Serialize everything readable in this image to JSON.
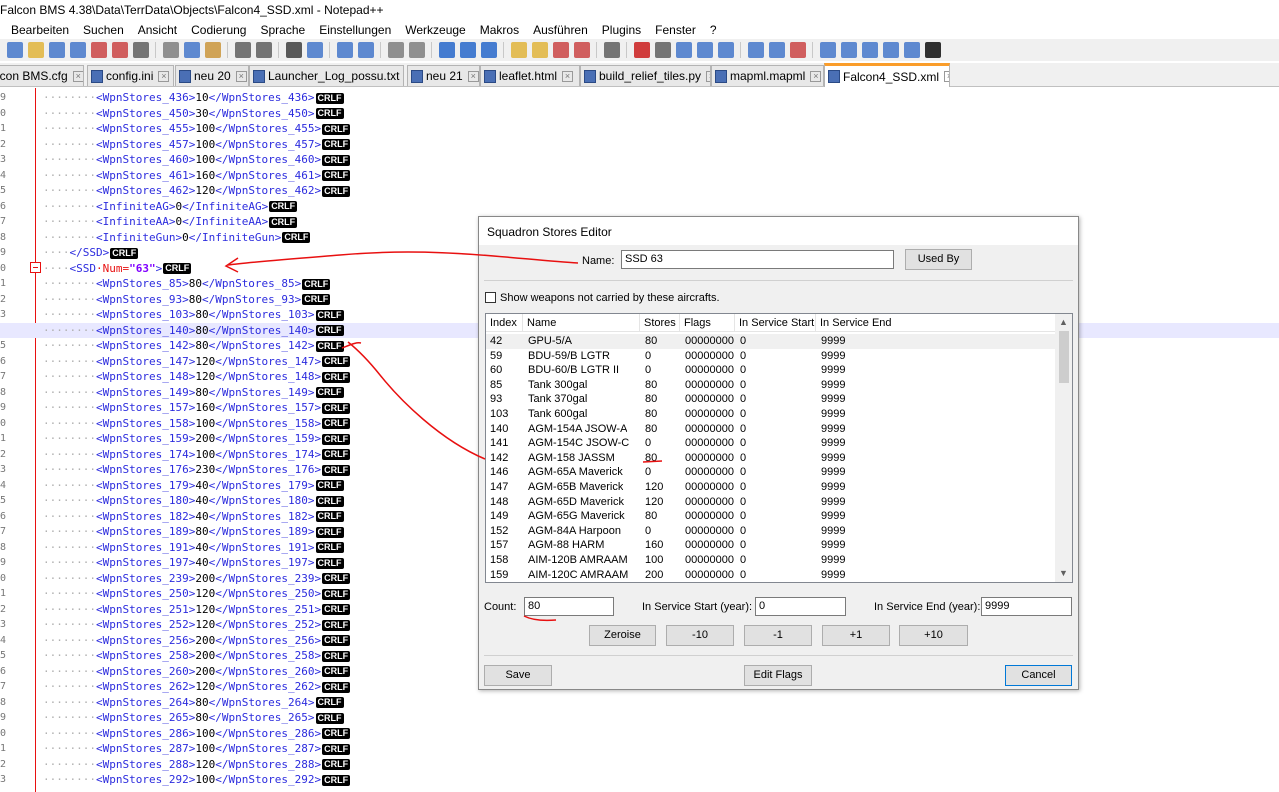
{
  "window": {
    "title": "Falcon BMS 4.38\\Data\\TerrData\\Objects\\Falcon4_SSD.xml - Notepad++"
  },
  "menu": [
    "Bearbeiten",
    "Suchen",
    "Ansicht",
    "Codierung",
    "Sprache",
    "Einstellungen",
    "Werkzeuge",
    "Makros",
    "Ausführen",
    "Plugins",
    "Fenster",
    "?"
  ],
  "tabs": [
    {
      "label": "lcon BMS.cfg"
    },
    {
      "label": "config.ini"
    },
    {
      "label": "neu 20"
    },
    {
      "label": "Launcher_Log_possu.txt"
    },
    {
      "label": "neu 21"
    },
    {
      "label": "leaflet.html"
    },
    {
      "label": "build_relief_tiles.py"
    },
    {
      "label": "mapml.mapml"
    },
    {
      "label": "Falcon4_SSD.xml"
    }
  ],
  "editor": {
    "line_numbers": [
      "9",
      "0",
      "1",
      "2",
      "3",
      "4",
      "5",
      "6",
      "7",
      "8",
      "9",
      "0",
      "1",
      "2",
      "3",
      "4",
      "5",
      "6",
      "7",
      "8",
      "9",
      "0",
      "1",
      "2",
      "3",
      "4",
      "5",
      "6",
      "7",
      "8",
      "9",
      "0",
      "1",
      "2",
      "3",
      "4",
      "5",
      "6",
      "7",
      "8",
      "9",
      "0",
      "1",
      "2",
      "3"
    ],
    "eol": "CRLF",
    "lines": [
      {
        "dots": "········",
        "open": "<WpnStores_436>",
        "value": "10",
        "close": "</WpnStores_436>"
      },
      {
        "dots": "········",
        "open": "<WpnStores_450>",
        "value": "30",
        "close": "</WpnStores_450>"
      },
      {
        "dots": "········",
        "open": "<WpnStores_455>",
        "value": "100",
        "close": "</WpnStores_455>"
      },
      {
        "dots": "········",
        "open": "<WpnStores_457>",
        "value": "100",
        "close": "</WpnStores_457>"
      },
      {
        "dots": "········",
        "open": "<WpnStores_460>",
        "value": "100",
        "close": "</WpnStores_460>"
      },
      {
        "dots": "········",
        "open": "<WpnStores_461>",
        "value": "160",
        "close": "</WpnStores_461>"
      },
      {
        "dots": "········",
        "open": "<WpnStores_462>",
        "value": "120",
        "close": "</WpnStores_462>"
      },
      {
        "dots": "········",
        "open": "<InfiniteAG>",
        "value": "0",
        "close": "</InfiniteAG>"
      },
      {
        "dots": "········",
        "open": "<InfiniteAA>",
        "value": "0",
        "close": "</InfiniteAA>"
      },
      {
        "dots": "········",
        "open": "<InfiniteGun>",
        "value": "0",
        "close": "</InfiniteGun>"
      },
      {
        "dots": "····",
        "open": "</SSD>",
        "value": "",
        "close": ""
      },
      {
        "dots": "····",
        "open": "<SSD",
        "attr": "·Num=",
        "attrval": "\"63\"",
        "open2": ">",
        "value": "",
        "close": ""
      },
      {
        "dots": "········",
        "open": "<WpnStores_85>",
        "value": "80",
        "close": "</WpnStores_85>"
      },
      {
        "dots": "········",
        "open": "<WpnStores_93>",
        "value": "80",
        "close": "</WpnStores_93>"
      },
      {
        "dots": "········",
        "open": "<WpnStores_103>",
        "value": "80",
        "close": "</WpnStores_103>"
      },
      {
        "dots": "········",
        "open": "<WpnStores_140>",
        "value": "80",
        "close": "</WpnStores_140>"
      },
      {
        "dots": "········",
        "open": "<WpnStores_142>",
        "value": "80",
        "close": "</WpnStores_142>"
      },
      {
        "dots": "········",
        "open": "<WpnStores_147>",
        "value": "120",
        "close": "</WpnStores_147>"
      },
      {
        "dots": "········",
        "open": "<WpnStores_148>",
        "value": "120",
        "close": "</WpnStores_148>"
      },
      {
        "dots": "········",
        "open": "<WpnStores_149>",
        "value": "80",
        "close": "</WpnStores_149>"
      },
      {
        "dots": "········",
        "open": "<WpnStores_157>",
        "value": "160",
        "close": "</WpnStores_157>"
      },
      {
        "dots": "········",
        "open": "<WpnStores_158>",
        "value": "100",
        "close": "</WpnStores_158>"
      },
      {
        "dots": "········",
        "open": "<WpnStores_159>",
        "value": "200",
        "close": "</WpnStores_159>"
      },
      {
        "dots": "········",
        "open": "<WpnStores_174>",
        "value": "100",
        "close": "</WpnStores_174>"
      },
      {
        "dots": "········",
        "open": "<WpnStores_176>",
        "value": "230",
        "close": "</WpnStores_176>"
      },
      {
        "dots": "········",
        "open": "<WpnStores_179>",
        "value": "40",
        "close": "</WpnStores_179>"
      },
      {
        "dots": "········",
        "open": "<WpnStores_180>",
        "value": "40",
        "close": "</WpnStores_180>"
      },
      {
        "dots": "········",
        "open": "<WpnStores_182>",
        "value": "40",
        "close": "</WpnStores_182>"
      },
      {
        "dots": "········",
        "open": "<WpnStores_189>",
        "value": "80",
        "close": "</WpnStores_189>"
      },
      {
        "dots": "········",
        "open": "<WpnStores_191>",
        "value": "40",
        "close": "</WpnStores_191>"
      },
      {
        "dots": "········",
        "open": "<WpnStores_197>",
        "value": "40",
        "close": "</WpnStores_197>"
      },
      {
        "dots": "········",
        "open": "<WpnStores_239>",
        "value": "200",
        "close": "</WpnStores_239>"
      },
      {
        "dots": "········",
        "open": "<WpnStores_250>",
        "value": "120",
        "close": "</WpnStores_250>"
      },
      {
        "dots": "········",
        "open": "<WpnStores_251>",
        "value": "120",
        "close": "</WpnStores_251>"
      },
      {
        "dots": "········",
        "open": "<WpnStores_252>",
        "value": "120",
        "close": "</WpnStores_252>"
      },
      {
        "dots": "········",
        "open": "<WpnStores_256>",
        "value": "200",
        "close": "</WpnStores_256>"
      },
      {
        "dots": "········",
        "open": "<WpnStores_258>",
        "value": "200",
        "close": "</WpnStores_258>"
      },
      {
        "dots": "········",
        "open": "<WpnStores_260>",
        "value": "200",
        "close": "</WpnStores_260>"
      },
      {
        "dots": "········",
        "open": "<WpnStores_262>",
        "value": "120",
        "close": "</WpnStores_262>"
      },
      {
        "dots": "········",
        "open": "<WpnStores_264>",
        "value": "80",
        "close": "</WpnStores_264>"
      },
      {
        "dots": "········",
        "open": "<WpnStores_265>",
        "value": "80",
        "close": "</WpnStores_265>"
      },
      {
        "dots": "········",
        "open": "<WpnStores_286>",
        "value": "100",
        "close": "</WpnStores_286>"
      },
      {
        "dots": "········",
        "open": "<WpnStores_287>",
        "value": "100",
        "close": "</WpnStores_287>"
      },
      {
        "dots": "········",
        "open": "<WpnStores_288>",
        "value": "120",
        "close": "</WpnStores_288>"
      },
      {
        "dots": "········",
        "open": "<WpnStores_292>",
        "value": "100",
        "close": "</WpnStores_292>"
      }
    ]
  },
  "dialog": {
    "title": "Squadron Stores Editor",
    "name_label": "Name:",
    "name_value": "SSD 63",
    "used_by_button": "Used By",
    "show_weapons_label": "Show weapons not carried by these aircrafts.",
    "columns": [
      "Index",
      "Name",
      "Stores",
      "Flags",
      "In Service Start",
      "In Service End"
    ],
    "rows": [
      [
        "42",
        "GPU-5/A",
        "80",
        "00000000",
        "0",
        "9999"
      ],
      [
        "59",
        "BDU-59/B LGTR",
        "0",
        "00000000",
        "0",
        "9999"
      ],
      [
        "60",
        "BDU-60/B LGTR II",
        "0",
        "00000000",
        "0",
        "9999"
      ],
      [
        "85",
        "Tank 300gal",
        "80",
        "00000000",
        "0",
        "9999"
      ],
      [
        "93",
        "Tank 370gal",
        "80",
        "00000000",
        "0",
        "9999"
      ],
      [
        "103",
        "Tank 600gal",
        "80",
        "00000000",
        "0",
        "9999"
      ],
      [
        "140",
        "AGM-154A JSOW-A",
        "80",
        "00000000",
        "0",
        "9999"
      ],
      [
        "141",
        "AGM-154C JSOW-C",
        "0",
        "00000000",
        "0",
        "9999"
      ],
      [
        "142",
        "AGM-158 JASSM",
        "80",
        "00000000",
        "0",
        "9999"
      ],
      [
        "146",
        "AGM-65A Maverick",
        "0",
        "00000000",
        "0",
        "9999"
      ],
      [
        "147",
        "AGM-65B Maverick",
        "120",
        "00000000",
        "0",
        "9999"
      ],
      [
        "148",
        "AGM-65D Maverick",
        "120",
        "00000000",
        "0",
        "9999"
      ],
      [
        "149",
        "AGM-65G Maverick",
        "80",
        "00000000",
        "0",
        "9999"
      ],
      [
        "152",
        "AGM-84A Harpoon",
        "0",
        "00000000",
        "0",
        "9999"
      ],
      [
        "157",
        "AGM-88 HARM",
        "160",
        "00000000",
        "0",
        "9999"
      ],
      [
        "158",
        "AIM-120B AMRAAM",
        "100",
        "00000000",
        "0",
        "9999"
      ],
      [
        "159",
        "AIM-120C AMRAAM",
        "200",
        "00000000",
        "0",
        "9999"
      ]
    ],
    "count_label": "Count:",
    "count_value": "80",
    "in_service_start_label": "In Service Start (year):",
    "in_service_start_value": "0",
    "in_service_end_label": "In Service End (year):",
    "in_service_end_value": "9999",
    "zeroise_button": "Zeroise",
    "minus10_button": "-10",
    "minus1_button": "-1",
    "plus1_button": "+1",
    "plus10_button": "+10",
    "save_button": "Save",
    "edit_flags_button": "Edit Flags",
    "cancel_button": "Cancel"
  },
  "colors": {
    "tag": "#2c2cde",
    "attribute": "#e81010",
    "attribute_value": "#8000ff",
    "active_tab_accent": "#fa9d2a",
    "annotation": "#e81010"
  }
}
